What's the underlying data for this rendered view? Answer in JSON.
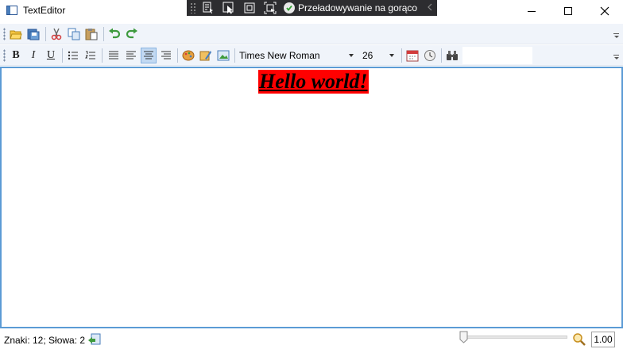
{
  "window": {
    "title": "TextEditor",
    "controls": [
      "minimize-icon",
      "maximize-icon",
      "close-icon"
    ]
  },
  "debug_toolbar": {
    "tools": [
      "live-visual-tree-icon",
      "select-element-icon",
      "display-layout-adorners-icon",
      "track-focused-element-icon"
    ],
    "hot_reload_label": "Przeładowywanie na gorąco",
    "status_icon": "check-circle-icon"
  },
  "toolbar_file": {
    "buttons": [
      "open-icon",
      "save-icon",
      "cut-icon",
      "copy-icon",
      "paste-icon",
      "undo-icon",
      "redo-icon"
    ]
  },
  "toolbar_format": {
    "bold_label": "B",
    "italic_label": "I",
    "underline_label": "U",
    "alignment_selected": "center",
    "font_family": "Times New Roman",
    "font_size": "26",
    "colors": {
      "accent": "#5b9bd5",
      "toolbar_bg": "#f0f4fa"
    }
  },
  "document": {
    "text": "Hello world!",
    "highlight_color": "#ff0000"
  },
  "statusbar": {
    "stats": "Znaki: 12; Słowa: 2",
    "zoom_value": "1.00"
  }
}
